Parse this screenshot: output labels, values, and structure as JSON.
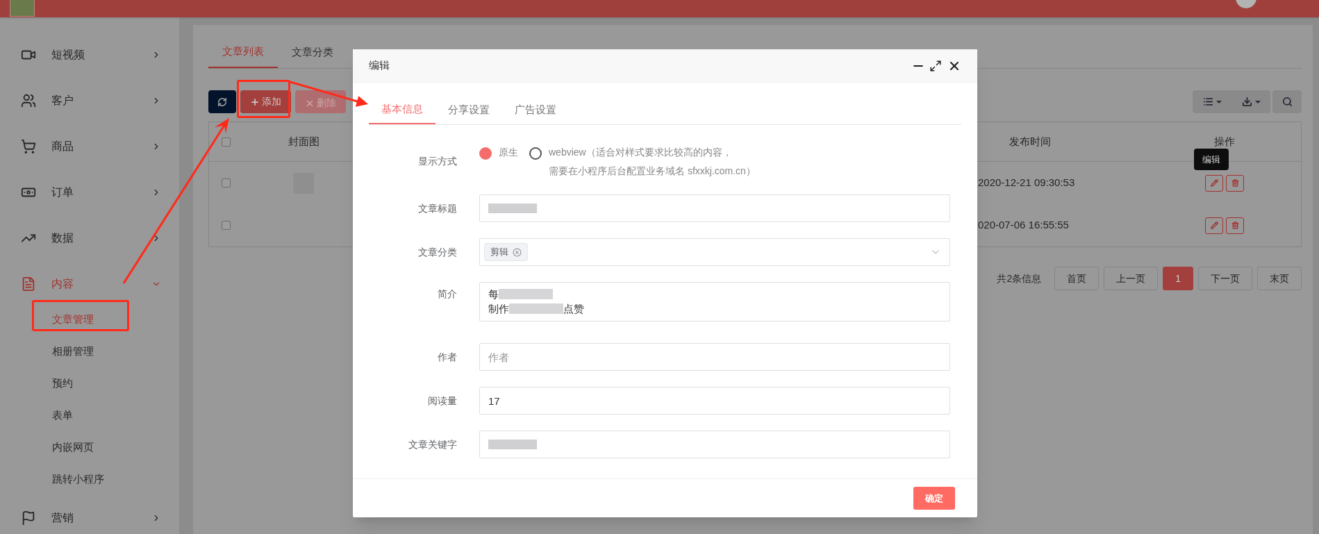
{
  "sidebar": {
    "items": [
      {
        "label": "短视频",
        "expanded": false,
        "selected": false
      },
      {
        "label": "客户",
        "expanded": false,
        "selected": false
      },
      {
        "label": "商品",
        "expanded": false,
        "selected": false
      },
      {
        "label": "订单",
        "expanded": false,
        "selected": false
      },
      {
        "label": "数据",
        "expanded": false,
        "selected": false
      },
      {
        "label": "内容",
        "expanded": true,
        "selected": true,
        "children": [
          {
            "label": "文章管理",
            "selected": true
          },
          {
            "label": "相册管理",
            "selected": false
          },
          {
            "label": "预约",
            "selected": false
          },
          {
            "label": "表单",
            "selected": false
          },
          {
            "label": "内嵌网页",
            "selected": false
          },
          {
            "label": "跳转小程序",
            "selected": false
          }
        ]
      },
      {
        "label": "营销",
        "expanded": false,
        "selected": false
      }
    ]
  },
  "page": {
    "tabs": [
      {
        "label": "文章列表",
        "selected": true
      },
      {
        "label": "文章分类",
        "selected": false
      }
    ],
    "toolbar": {
      "buttons": [
        {
          "label": "添加",
          "disabled": false
        },
        {
          "label": "删除",
          "disabled": true
        }
      ]
    },
    "table": {
      "header_checked": false,
      "columns": [
        "封面图",
        "发布时间",
        "操作"
      ],
      "rows": [
        {
          "checked": false,
          "thumbnail": true,
          "published": "2020-12-21 09:30:53",
          "tooltip": "编辑"
        },
        {
          "checked": false,
          "published": "020-07-06 16:55:55"
        }
      ]
    },
    "pagination": {
      "summary": "共2条信息",
      "pages": [
        {
          "label": "首页",
          "selected": false
        },
        {
          "label": "上一页",
          "selected": false
        },
        {
          "label": "1",
          "selected": true
        },
        {
          "label": "下一页",
          "selected": false
        },
        {
          "label": "末页",
          "selected": false
        }
      ]
    }
  },
  "modal": {
    "title": "编辑",
    "tabs": [
      {
        "label": "基本信息",
        "selected": true
      },
      {
        "label": "分享设置",
        "selected": false
      },
      {
        "label": "广告设置",
        "selected": false
      }
    ],
    "fields": [
      {
        "kind": "radio",
        "label": "显示方式",
        "options": [
          {
            "label": "原生",
            "selected": true
          },
          {
            "label": "webview（适合对样式要求比较高的内容，",
            "note": "需要在小程序后台配置业务域名 sfxxkj.com.cn）",
            "selected": false
          }
        ]
      },
      {
        "kind": "blurred",
        "label": "文章标题"
      },
      {
        "kind": "tags",
        "label": "文章分类",
        "tags": [
          "剪辑"
        ]
      },
      {
        "kind": "textarea",
        "label": "简介",
        "lines": [
          {
            "before": "每"
          },
          {
            "before": "制作",
            "after": "点赞"
          }
        ]
      },
      {
        "kind": "text",
        "label": "作者",
        "placeholder": "作者"
      },
      {
        "kind": "text",
        "label": "阅读量",
        "value": "17"
      },
      {
        "kind": "blurred",
        "label": "文章关键字"
      }
    ],
    "confirm": "确定"
  }
}
